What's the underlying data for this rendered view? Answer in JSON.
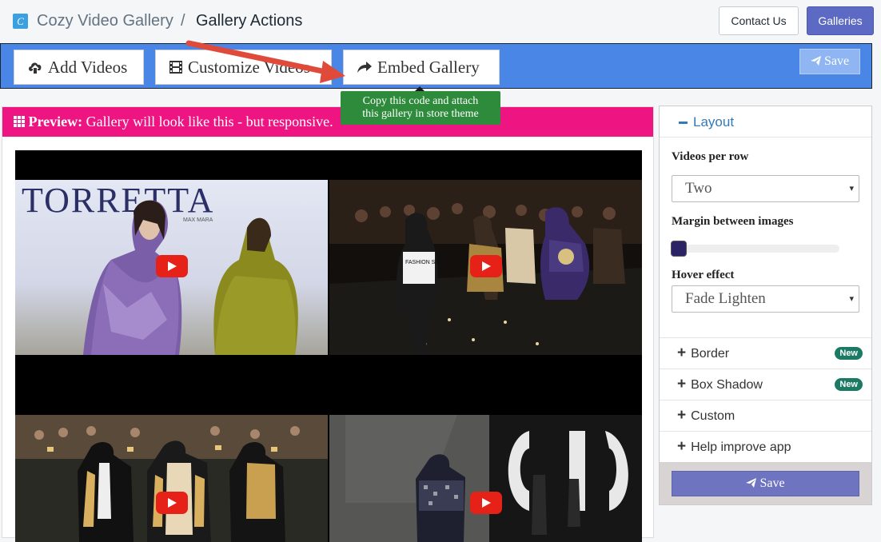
{
  "header": {
    "app_name": "Cozy Video Gallery",
    "separator": "/",
    "page_title": "Gallery Actions",
    "contact_label": "Contact Us",
    "galleries_label": "Galleries"
  },
  "actions": {
    "add_videos": "Add Videos",
    "customize_videos": "Customize Videos",
    "embed_gallery": "Embed Gallery",
    "save": "Save"
  },
  "tooltip": {
    "line1": "Copy this code and attach",
    "line2": "this gallery in store theme"
  },
  "preview": {
    "label": "Preview:",
    "text": "Gallery will look like this - but responsive."
  },
  "videos": [
    {
      "sign_text": "TORRETTA",
      "subtitle_text": "MAX MARA"
    },
    {
      "shirt_text": "FASHION SINNER"
    },
    {},
    {}
  ],
  "sidebar": {
    "layout_title": "Layout",
    "videos_per_row_label": "Videos per row",
    "videos_per_row_value": "Two",
    "margin_label": "Margin between images",
    "margin_value": 0,
    "hover_label": "Hover effect",
    "hover_value": "Fade Lighten",
    "sections": [
      {
        "label": "Border",
        "badge": "New"
      },
      {
        "label": "Box Shadow",
        "badge": "New"
      },
      {
        "label": "Custom",
        "badge": ""
      },
      {
        "label": "Help improve app",
        "badge": ""
      }
    ],
    "save": "Save"
  },
  "colors": {
    "action_bar": "#4986e6",
    "preview_bar": "#ee1583",
    "tooltip": "#2e8b3c",
    "primary": "#5c6ac4",
    "badge": "#1a7a63",
    "arrow": "#e04a3a"
  },
  "icons": {
    "logo": "cozy-logo-icon",
    "add_videos": "cloud-upload-icon",
    "customize": "film-icon",
    "embed": "share-arrow-icon",
    "save": "paper-plane-icon",
    "preview": "grid-icon",
    "video": "youtube-play-icon"
  }
}
